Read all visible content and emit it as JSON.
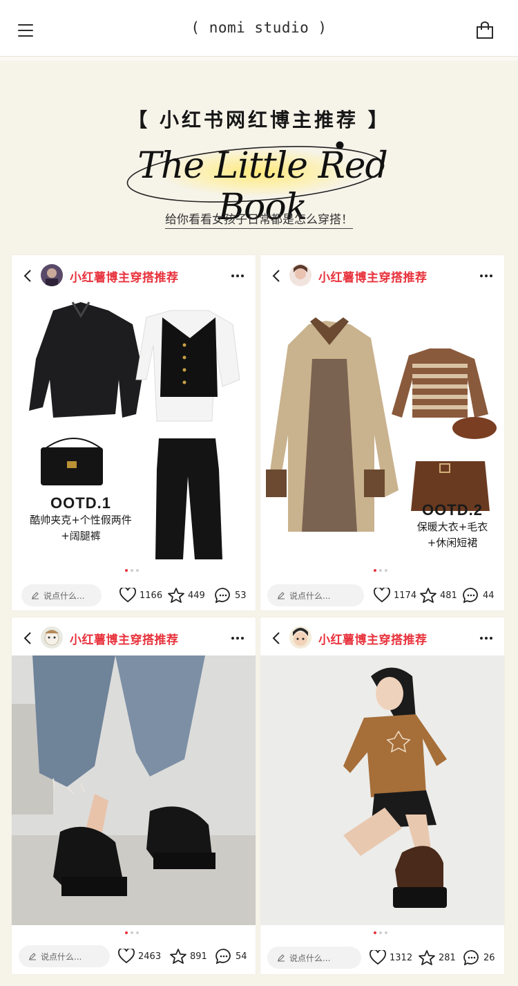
{
  "header": {
    "brand": "( nomi studio )",
    "menu_icon": "hamburger-menu-icon",
    "cart_icon": "shopping-bag-icon"
  },
  "hero": {
    "title_cn": "【 小红书网红博主推荐 】",
    "title_en": "The Little Red Book",
    "subtitle": "给你看看女孩子日常都是怎么穿搭！"
  },
  "colors": {
    "page_bg": "#f6f3e9",
    "accent_red": "#e8323c",
    "highlight_yellow": "#ffe978"
  },
  "cards": [
    {
      "user": "小红薯博主穿搭推荐",
      "ootd_title": "OOTD.1",
      "ootd_line1": "酷帅夹克+个性假两件",
      "ootd_line2": "+阔腿裤",
      "comment_placeholder": "说点什么...",
      "likes": "1166",
      "stars": "449",
      "comments": "53"
    },
    {
      "user": "小红薯博主穿搭推荐",
      "ootd_title": "OOTD.2",
      "ootd_line1": "保暖大衣+毛衣",
      "ootd_line2": "+休闲短裙",
      "comment_placeholder": "说点什么...",
      "likes": "1174",
      "stars": "481",
      "comments": "44"
    },
    {
      "user": "小红薯博主穿搭推荐",
      "comment_placeholder": "说点什么...",
      "likes": "2463",
      "stars": "891",
      "comments": "54"
    },
    {
      "user": "小红薯博主穿搭推荐",
      "comment_placeholder": "说点什么...",
      "likes": "1312",
      "stars": "281",
      "comments": "26"
    }
  ]
}
